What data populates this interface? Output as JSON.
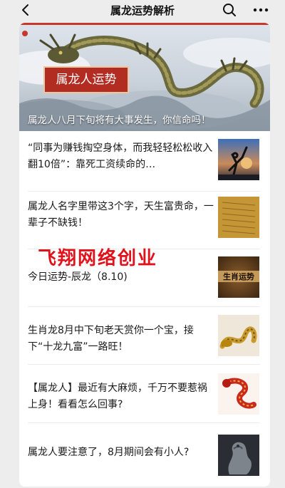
{
  "nav": {
    "title": "属龙运势解析"
  },
  "banner": {
    "tag": "属龙人运势",
    "caption": "属龙人八月下旬将有大事发生，你信命吗！"
  },
  "articles": [
    {
      "title": "“同事为赚钱掏空身体，而我轻轻松松收入翻10倍”：靠死工资续命的…",
      "thumb": "dancer-silhouette"
    },
    {
      "title": "属龙人名字里带这3个字，天生富贵命，一辈子不缺钱！",
      "thumb": "golden-scroll"
    },
    {
      "title": "今日运势-辰龙（8.10)",
      "thumb": "zodiac-fortune-card",
      "thumb_label": "生肖运势"
    },
    {
      "title": "生肖龙8月中下旬老天赏你一个宝，接下“十龙九富”一路旺！",
      "thumb": "golden-dragon"
    },
    {
      "title": "【属龙人】最近有大麻烦，千万不要惹祸上身！看看怎么回事?",
      "thumb": "red-dragon"
    },
    {
      "title": "属龙人要注意了，8月期间会有小人?",
      "thumb": "stone-dragon-statue"
    }
  ],
  "watermark": "飞翔网络创业",
  "colors": {
    "accent_red": "#c8362c",
    "watermark_red": "#e0131c",
    "background": "#ededed"
  }
}
